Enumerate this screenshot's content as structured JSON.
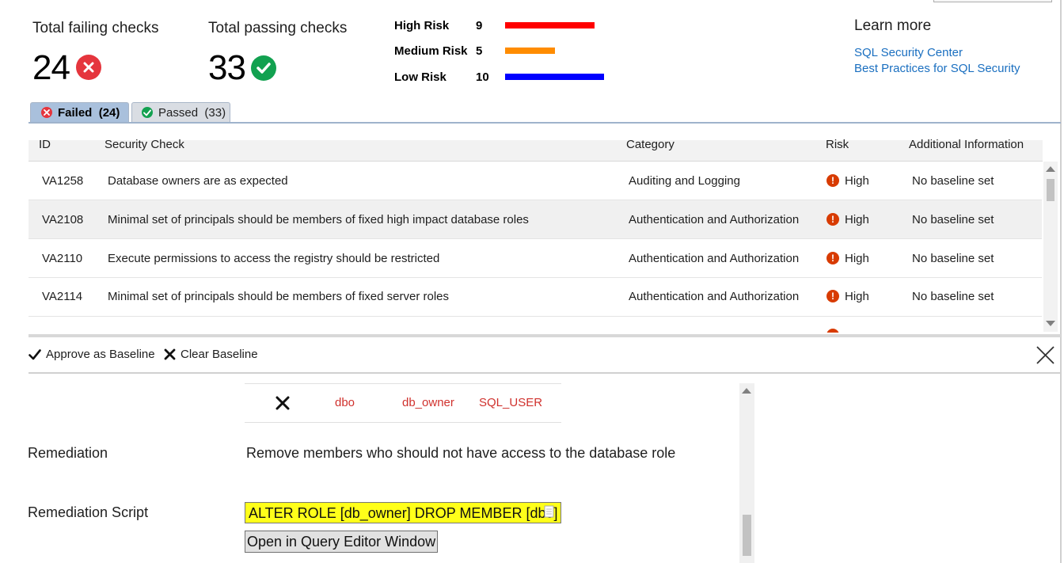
{
  "summary": {
    "failing_label": "Total failing checks",
    "failing_count": "24",
    "passing_label": "Total passing checks",
    "passing_count": "33"
  },
  "risks": [
    {
      "label": "High Risk",
      "count": "9",
      "value": 9,
      "color": "#ff0000"
    },
    {
      "label": "Medium Risk",
      "count": "5",
      "value": 5,
      "color": "#ff8c00"
    },
    {
      "label": "Low Risk",
      "count": "10",
      "value": 10,
      "color": "#0000ff"
    }
  ],
  "learn_more": {
    "title": "Learn more",
    "links": [
      "SQL Security Center",
      "Best Practices for SQL Security"
    ]
  },
  "tabs": {
    "failed_label": "Failed",
    "failed_count": "(24)",
    "passed_label": "Passed",
    "passed_count": "(33)"
  },
  "table": {
    "headers": [
      "ID",
      "Security Check",
      "Category",
      "Risk",
      "Additional Information"
    ],
    "rows": [
      {
        "id": "VA1258",
        "check": "Database owners are as expected",
        "category": "Auditing and Logging",
        "risk": "High",
        "info": "No baseline set"
      },
      {
        "id": "VA2108",
        "check": "Minimal set of principals should be members of fixed high impact database roles",
        "category": "Authentication and Authorization",
        "risk": "High",
        "info": "No baseline set"
      },
      {
        "id": "VA2110",
        "check": "Execute permissions to access the registry should be restricted",
        "category": "Authentication and Authorization",
        "risk": "High",
        "info": "No baseline set"
      },
      {
        "id": "VA2114",
        "check": "Minimal set of principals should be members of fixed server roles",
        "category": "Authentication and Authorization",
        "risk": "High",
        "info": "No baseline set"
      }
    ]
  },
  "toolbar": {
    "approve_label": "Approve as Baseline",
    "clear_label": "Clear Baseline"
  },
  "detail": {
    "result_row": [
      "dbo",
      "db_owner",
      "SQL_USER"
    ],
    "remediation_label": "Remediation",
    "remediation_text": "Remove members who should not have access to the database role",
    "script_label": "Remediation Script",
    "script_text": "ALTER ROLE [db_owner] DROP MEMBER [dbo]",
    "open_button": "Open in Query Editor Window"
  },
  "colors": {
    "fail": "#e5353d",
    "pass": "#12a150",
    "risk_icon": "#d83b01",
    "link": "#1a6fc0",
    "highlight": "#ffff1a"
  }
}
